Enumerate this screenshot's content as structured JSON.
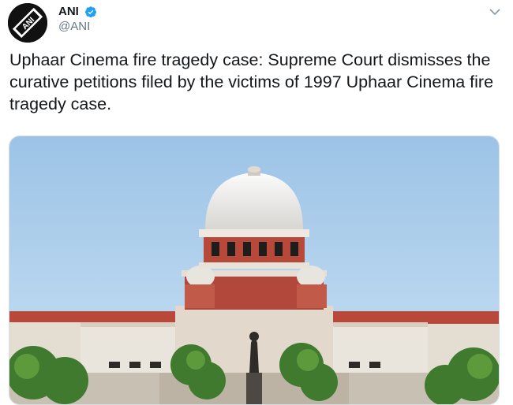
{
  "tweet": {
    "author": {
      "display_name": "ANI",
      "handle": "@ANI",
      "avatar_text": "ANI",
      "verified": true
    },
    "text": "Uphaar Cinema fire tragedy case: Supreme Court dismisses the curative petitions filed by the victims of 1997 Uphaar Cinema fire tragedy case.",
    "media": {
      "icon": "supreme-court-building-photo"
    }
  },
  "colors": {
    "text": "#14171a",
    "secondary_text": "#657786",
    "verified_blue": "#1da1f2",
    "media_border": "#d6dfe6"
  }
}
